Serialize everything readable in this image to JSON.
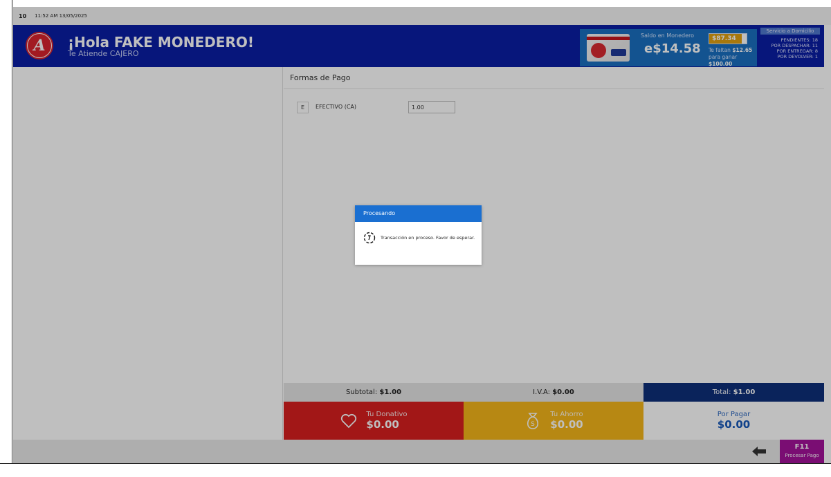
{
  "status_bar": {
    "terminal": "10",
    "datetime": "11:52 AM 13/05/2025"
  },
  "header": {
    "logo_letter": "A",
    "greeting": "¡Hola FAKE MONEDERO!",
    "attendant": "Te Atiende CAJERO",
    "monedero": {
      "saldo_label": "Saldo en Monedero",
      "saldo_value": "e$14.58",
      "progress_amount": "$87.34",
      "progress_fraction": 0.8734,
      "faltan_prefix": "Te faltan",
      "faltan_amount": "$12.65",
      "ganar_prefix": "para ganar",
      "ganar_amount": "$100.00"
    },
    "servicio": {
      "title": "Servicio a Domicilio",
      "pendientes": "PENDIENTES: 18",
      "por_despachar": "POR DESPACHAR: 11",
      "por_entregar": "POR ENTREGAR: 8",
      "por_devolver": "POR DEVOLVER: 1"
    }
  },
  "main": {
    "title": "Formas de Pago",
    "payments": [
      {
        "key": "E",
        "name": "EFECTIVO (CA)",
        "value": "1.00"
      }
    ]
  },
  "totals": {
    "subtotal_label": "Subtotal:",
    "subtotal_value": "$1.00",
    "iva_label": "I.V.A:",
    "iva_value": "$0.00",
    "total_label": "Total:",
    "total_value": "$1.00"
  },
  "summary": {
    "donativo_label": "Tu Donativo",
    "donativo_value": "$0.00",
    "ahorro_label": "Tu Ahorro",
    "ahorro_value": "$0.00",
    "por_pagar_label": "Por Pagar",
    "por_pagar_value": "$0.00"
  },
  "footer": {
    "f11_key": "F11",
    "f11_label": "Procesar Pago"
  },
  "dialog": {
    "title": "Procesando",
    "message": "Transacción en proceso. Favor de esperar."
  },
  "colors": {
    "header_bg": "#0a1ea4",
    "monedero_bg": "#1a6fc0",
    "total_bg": "#0e2f7a",
    "donativo_bg": "#d81f1f",
    "ahorro_bg": "#f5b61a",
    "f11_bg": "#a3129a",
    "dialog_title_bg": "#1a6fd1"
  }
}
